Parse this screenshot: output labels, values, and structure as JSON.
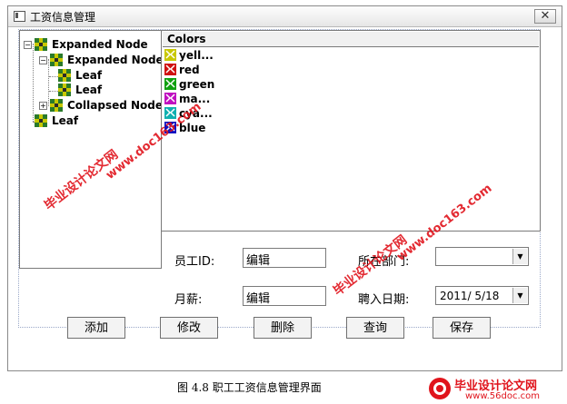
{
  "window": {
    "title": "工资信息管理",
    "close_glyph": "✕"
  },
  "tree": {
    "nodes": [
      {
        "label": "Expanded Node",
        "expander": "−",
        "icon": "tree-node-bitmap-icon"
      },
      {
        "label": "Expanded Node",
        "expander": "−",
        "icon": "tree-node-bitmap-icon"
      },
      {
        "label": "Leaf",
        "icon": "tree-node-bitmap-icon"
      },
      {
        "label": "Leaf",
        "icon": "tree-node-bitmap-icon"
      },
      {
        "label": "Collapsed Node",
        "expander": "+",
        "icon": "tree-node-bitmap-icon"
      },
      {
        "label": "Leaf",
        "icon": "tree-node-bitmap-icon"
      }
    ]
  },
  "list": {
    "column_header": "Colors",
    "items": [
      {
        "label": "yell...",
        "color": "#c8c800"
      },
      {
        "label": "red",
        "color": "#d01010"
      },
      {
        "label": "green",
        "color": "#10a010"
      },
      {
        "label": "ma...",
        "color": "#c010c0"
      },
      {
        "label": "cya...",
        "color": "#10b0b0"
      },
      {
        "label": "blue",
        "color": "#1010c0"
      }
    ]
  },
  "form": {
    "employee_id_label": "员工ID:",
    "employee_id_value": "编辑",
    "department_label": "所在部门:",
    "department_value": "",
    "salary_label": "月薪:",
    "salary_value": "编辑",
    "hire_date_label": "聘入日期:",
    "hire_date_value": "2011/ 5/18"
  },
  "buttons": {
    "add": "添加",
    "edit": "修改",
    "delete": "删除",
    "query": "查询",
    "save": "保存"
  },
  "caption": "图 4.8  职工工资信息管理界面",
  "watermarks": {
    "text_cn": "毕业设计论文网",
    "text_url": "www.doc163.com",
    "logo_cn": "毕业设计论文网",
    "logo_url": "www.56doc.com"
  },
  "colors": {
    "watermark": "#e0141c",
    "tree_icon_yellow": "#c8c800",
    "tree_icon_green": "#2a7a2a"
  }
}
